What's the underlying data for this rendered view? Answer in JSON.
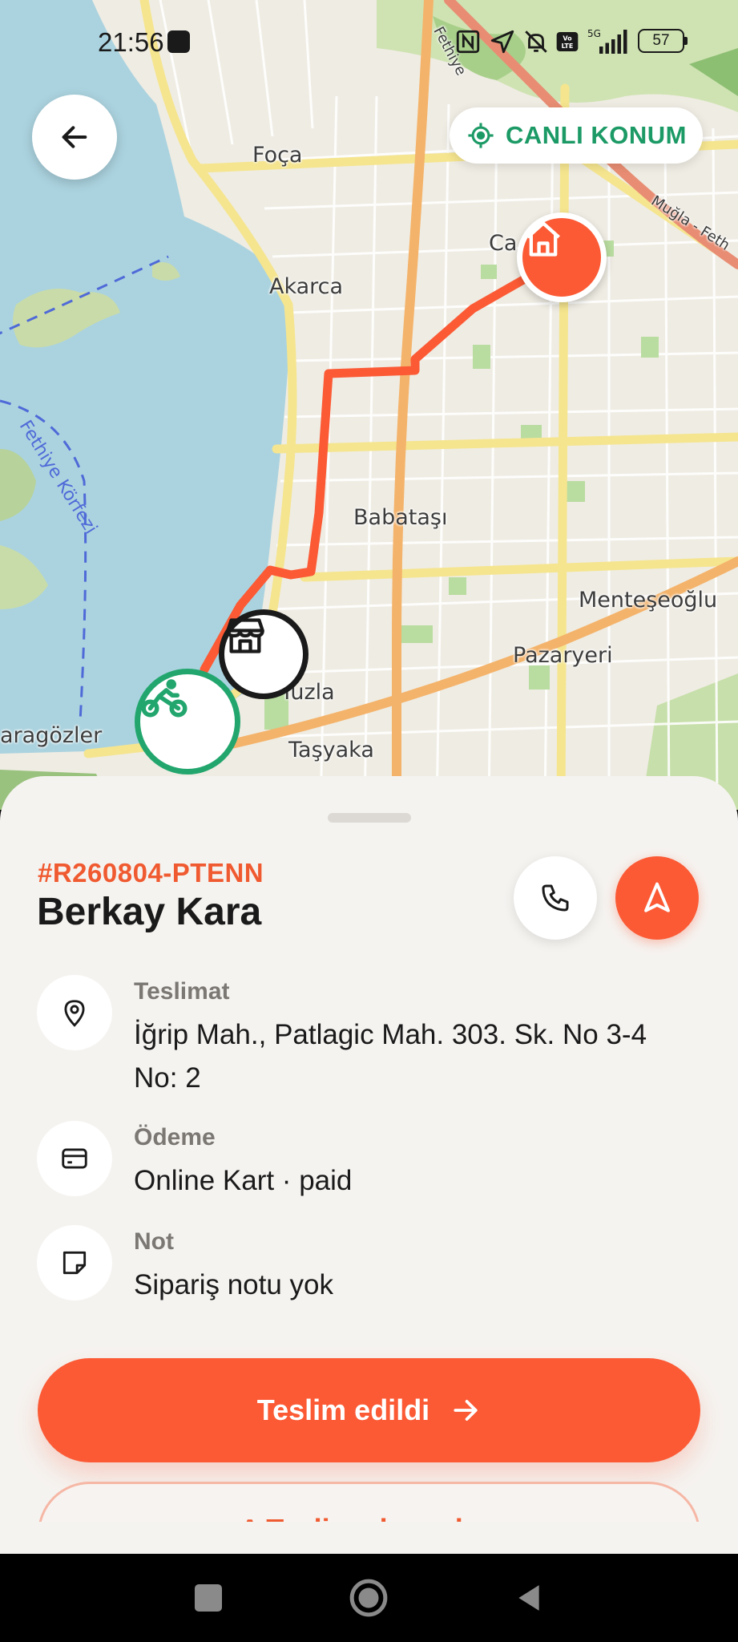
{
  "status_bar": {
    "time": "21:56",
    "battery": "57"
  },
  "map": {
    "live_location_label": "CANLI KONUM",
    "labels": {
      "foca": "Foça",
      "akarca": "Akarca",
      "babatasi": "Babataşı",
      "mentesoglu": "Menteşeoğlu",
      "pazaryeri": "Pazaryeri",
      "tasyaka": "Taşyaka",
      "tuzla": "Tuzla",
      "karagozler": "aragözler",
      "cal": "Ca",
      "fethiye_korfezi": "Fethiye Körfezi",
      "mugla_fethiye": "Muğla - Fethiye",
      "fethiye_road": "Fethiye",
      "mugla_road": "Muğla - Feth"
    }
  },
  "sheet": {
    "order_code": "#R260804-PTENN",
    "customer_name": "Berkay Kara",
    "rows": [
      {
        "label": "Teslimat",
        "value": "İğrip Mah., Patlagic Mah. 303. Sk. No 3-4 No: 2",
        "icon": "location-pin-icon"
      },
      {
        "label": "Ödeme",
        "value": "Online Kart · paid",
        "icon": "credit-card-icon"
      },
      {
        "label": "Not",
        "value": "Sipariş notu yok",
        "icon": "sticky-note-icon"
      }
    ],
    "primary_action": "Teslim edildi",
    "secondary_action": "^ Teslim alamadım"
  },
  "colors": {
    "accent": "#fb5a35",
    "live_green": "#1c9a66",
    "courier_green": "#22a66e",
    "sheet_bg": "#f5f3f0"
  }
}
